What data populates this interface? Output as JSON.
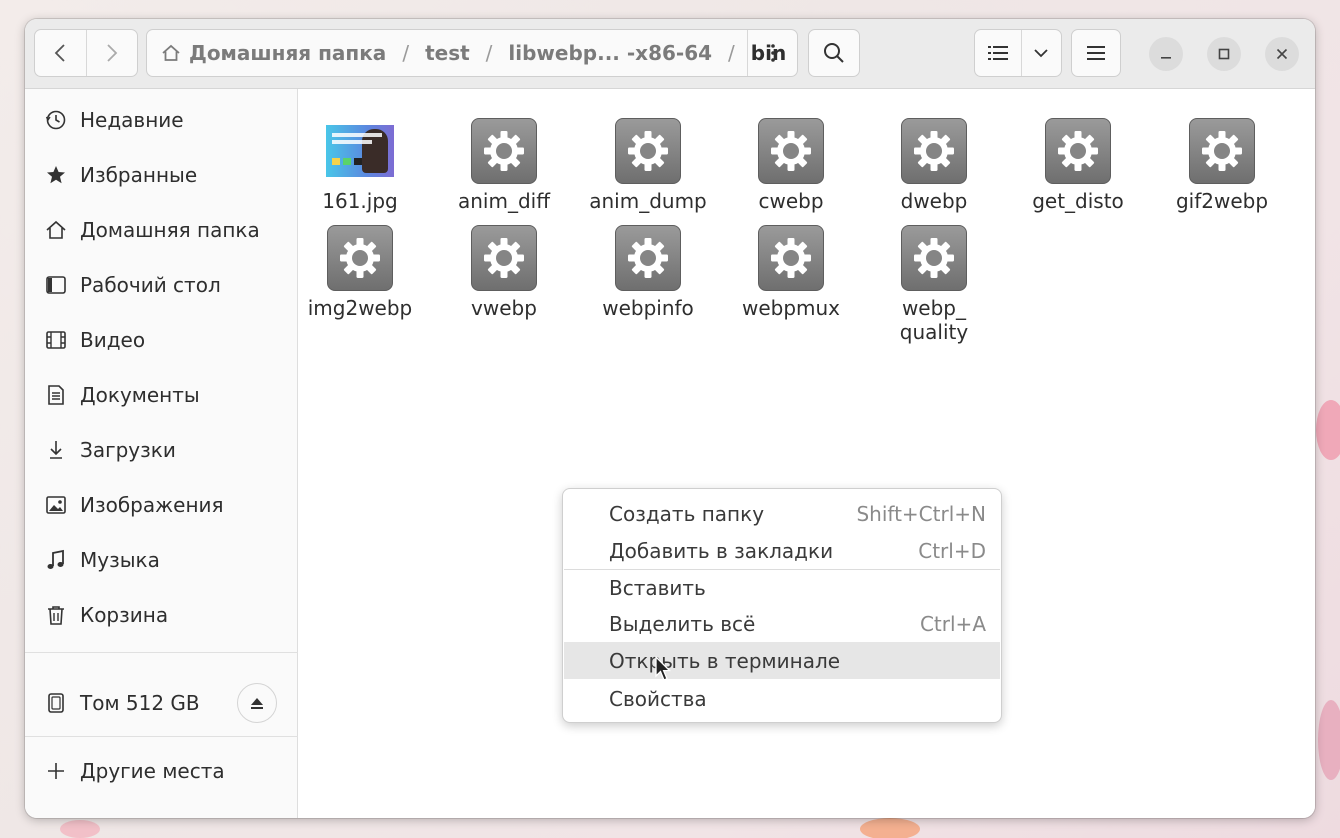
{
  "path": {
    "crumbs": [
      "Домашняя папка",
      "/",
      "test",
      "/",
      "libwebp... -x86-64",
      "/",
      "bin"
    ]
  },
  "sidebar": {
    "items": [
      {
        "label": "Недавние",
        "icon": "clock-icon"
      },
      {
        "label": "Избранные",
        "icon": "star-icon"
      },
      {
        "label": "Домашняя папка",
        "icon": "home-icon"
      },
      {
        "label": "Рабочий стол",
        "icon": "desktop-icon"
      },
      {
        "label": "Видео",
        "icon": "video-icon"
      },
      {
        "label": "Документы",
        "icon": "document-icon"
      },
      {
        "label": "Загрузки",
        "icon": "download-icon"
      },
      {
        "label": "Изображения",
        "icon": "image-icon"
      },
      {
        "label": "Музыка",
        "icon": "music-icon"
      },
      {
        "label": "Корзина",
        "icon": "trash-icon"
      }
    ],
    "volume": {
      "label": "Том 512 GB",
      "icon": "drive-icon"
    },
    "other": {
      "label": "Другие места",
      "icon": "plus-icon"
    }
  },
  "files": [
    {
      "name": "161.jpg",
      "type": "image"
    },
    {
      "name": "anim_diff",
      "type": "executable"
    },
    {
      "name": "anim_dump",
      "type": "executable"
    },
    {
      "name": "cwebp",
      "type": "executable"
    },
    {
      "name": "dwebp",
      "type": "executable"
    },
    {
      "name": "get_disto",
      "type": "executable"
    },
    {
      "name": "gif2webp",
      "type": "executable"
    },
    {
      "name": "img2webp",
      "type": "executable"
    },
    {
      "name": "vwebp",
      "type": "executable"
    },
    {
      "name": "webpinfo",
      "type": "executable"
    },
    {
      "name": "webpmux",
      "type": "executable"
    },
    {
      "name": "webp_\nquality",
      "type": "executable"
    }
  ],
  "context_menu": {
    "items": [
      {
        "label": "Создать папку",
        "shortcut": "Shift+Ctrl+N"
      },
      {
        "label": "Добавить в закладки",
        "shortcut": "Ctrl+D"
      },
      {
        "label": "Вставить",
        "shortcut": ""
      },
      {
        "label": "Выделить всё",
        "shortcut": "Ctrl+A"
      },
      {
        "label": "Открыть в терминале",
        "shortcut": "",
        "highlighted": true
      },
      {
        "label": "Свойства",
        "shortcut": ""
      }
    ]
  },
  "colors": {
    "accent": "#e6e6e6",
    "text": "#2e2e2e",
    "exec_icon": "#7f7f7f"
  }
}
